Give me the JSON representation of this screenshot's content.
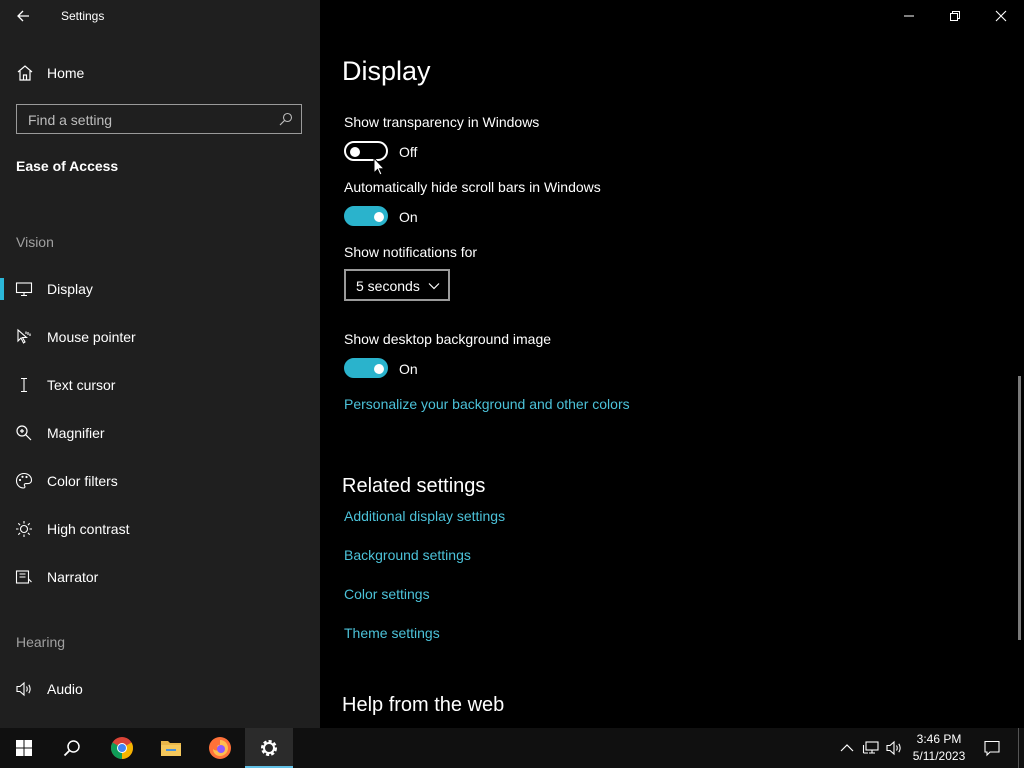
{
  "window": {
    "title": "Settings"
  },
  "sidebar": {
    "home_label": "Home",
    "search_placeholder": "Find a setting",
    "breadcrumb": "Ease of Access",
    "section_vision": "Vision",
    "section_hearing": "Hearing",
    "items": [
      {
        "label": "Display",
        "icon": "monitor-icon",
        "active": true
      },
      {
        "label": "Mouse pointer",
        "icon": "mouse-pointer-icon"
      },
      {
        "label": "Text cursor",
        "icon": "text-cursor-icon"
      },
      {
        "label": "Magnifier",
        "icon": "magnifier-icon"
      },
      {
        "label": "Color filters",
        "icon": "palette-icon"
      },
      {
        "label": "High contrast",
        "icon": "sun-icon"
      },
      {
        "label": "Narrator",
        "icon": "narrator-icon"
      },
      {
        "label": "Audio",
        "icon": "speaker-icon"
      }
    ]
  },
  "main": {
    "title": "Display",
    "transparency": {
      "label": "Show transparency in Windows",
      "state": "Off"
    },
    "scrollbars": {
      "label": "Automatically hide scroll bars in Windows",
      "state": "On"
    },
    "notifications": {
      "label": "Show notifications for",
      "value": "5 seconds"
    },
    "desktop_bg": {
      "label": "Show desktop background image",
      "state": "On"
    },
    "personalize_link": "Personalize your background and other colors",
    "related": {
      "title": "Related settings",
      "links": [
        "Additional display settings",
        "Background settings",
        "Color settings",
        "Theme settings"
      ]
    },
    "help_title": "Help from the web"
  },
  "taskbar": {
    "time": "3:46 PM",
    "date": "5/11/2023"
  },
  "colors": {
    "accent": "#2ab3cc",
    "link": "#4cc2d9",
    "sidebar_bg": "#1f1f1f"
  }
}
